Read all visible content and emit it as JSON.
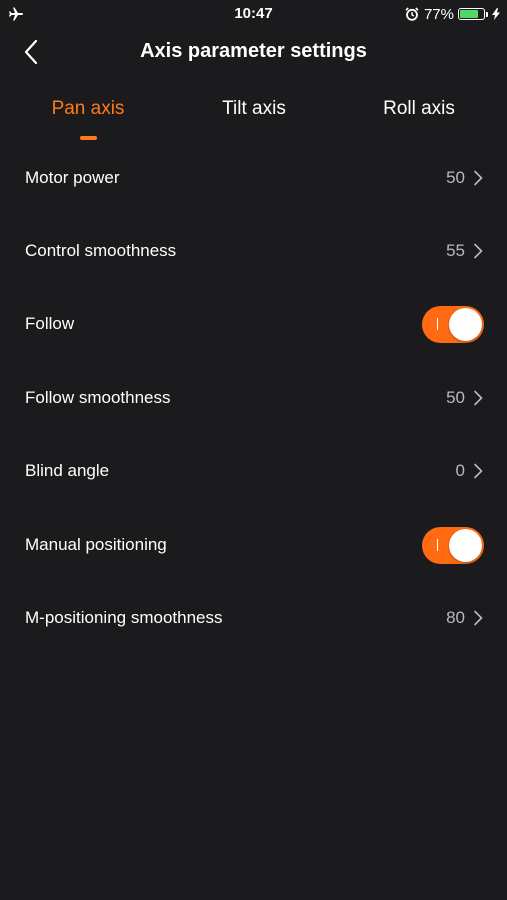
{
  "status_bar": {
    "time": "10:47",
    "battery_percent": "77%",
    "battery_level": 0.77,
    "battery_color": "#4cd964",
    "left_icon": "airplane-icon",
    "right_icons": [
      "alarm-icon",
      "battery-icon",
      "charging-bolt-icon"
    ]
  },
  "nav": {
    "title": "Axis parameter settings",
    "back_icon": "chevron-left-icon"
  },
  "tabs": [
    {
      "label": "Pan axis",
      "active": true
    },
    {
      "label": "Tilt axis",
      "active": false
    },
    {
      "label": "Roll axis",
      "active": false
    }
  ],
  "settings": [
    {
      "label": "Motor power",
      "type": "value",
      "value": "50"
    },
    {
      "label": "Control smoothness",
      "type": "value",
      "value": "55"
    },
    {
      "label": "Follow",
      "type": "toggle",
      "on": true
    },
    {
      "label": "Follow smoothness",
      "type": "value",
      "value": "50"
    },
    {
      "label": "Blind angle",
      "type": "value",
      "value": "0"
    },
    {
      "label": "Manual positioning",
      "type": "toggle",
      "on": true
    },
    {
      "label": "M-positioning smoothness",
      "type": "value",
      "value": "80"
    }
  ],
  "colors": {
    "background": "#1b1b1d",
    "accent": "#ff7a1a",
    "toggle_on": "#ff6a13",
    "value_text": "#b9b9bd"
  }
}
